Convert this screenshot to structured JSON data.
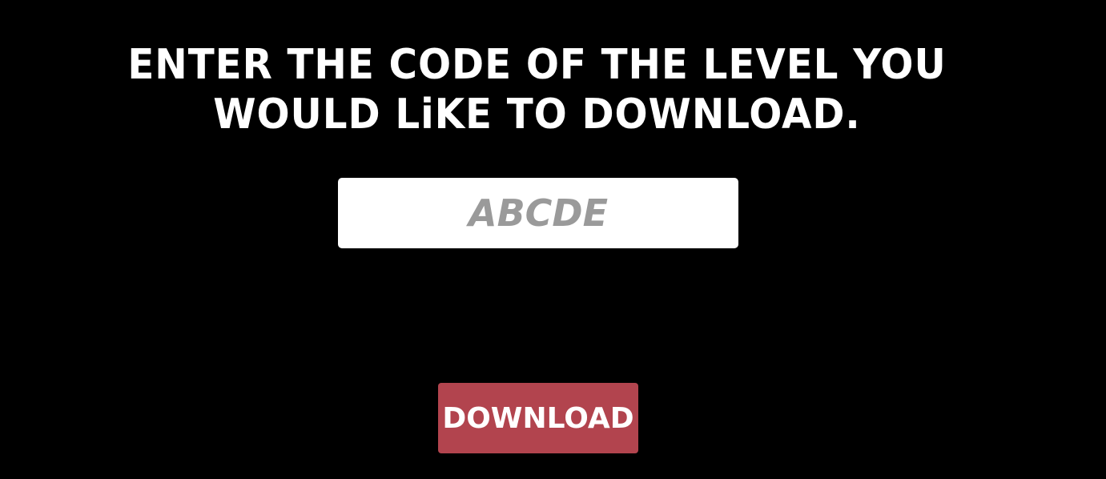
{
  "prompt": {
    "text": "ENTER THE CODE OF THE LEVEL YOU WOULD LiKE TO DOWNLOAD."
  },
  "code_input": {
    "value": "",
    "placeholder": "ABCDE"
  },
  "download_button": {
    "label": "DOWNLOAD"
  },
  "colors": {
    "background": "#000000",
    "text": "#ffffff",
    "input_background": "#ffffff",
    "placeholder": "#9a9a9a",
    "button_background": "#b2444e"
  }
}
